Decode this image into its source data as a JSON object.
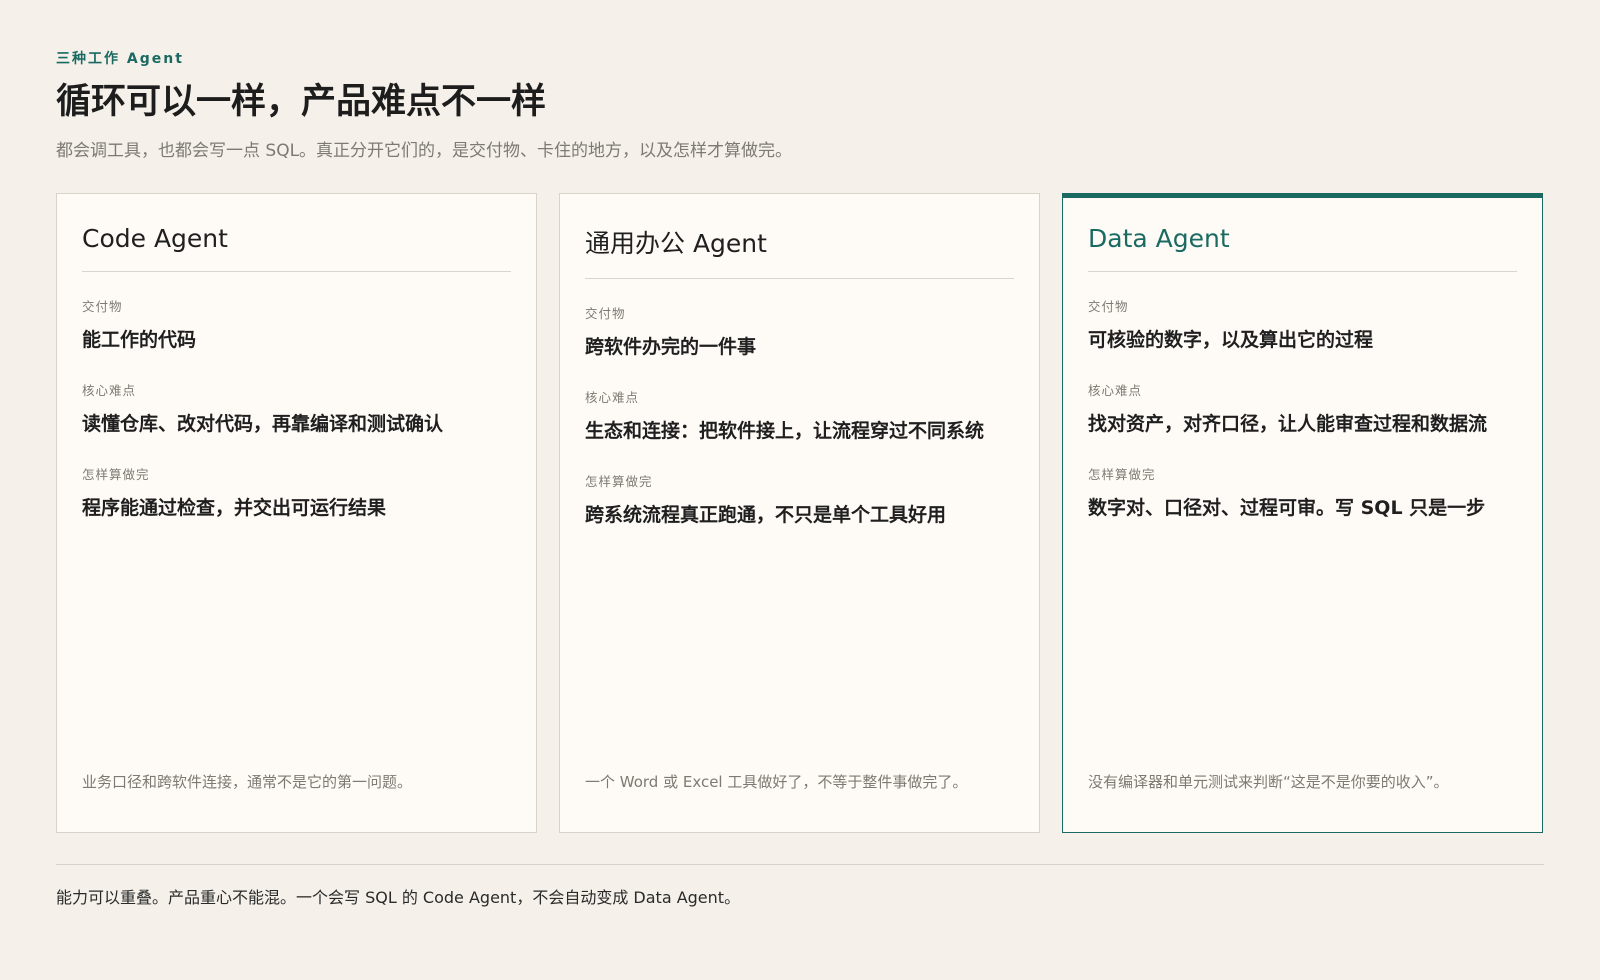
{
  "header": {
    "kicker": "三种工作 Agent",
    "title": "循环可以一样，产品难点不一样",
    "subtitle": "都会调工具，也都会写一点 SQL。真正分开它们的，是交付物、卡住的地方，以及怎样才算做完。"
  },
  "cards": [
    {
      "title": "Code Agent",
      "deliverable_label": "交付物",
      "deliverable": "能工作的代码",
      "difficulty_label": "核心难点",
      "difficulty": "读懂仓库、改对代码，再靠编译和测试确认",
      "done_label": "怎样算做完",
      "done": "程序能通过检查，并交出可运行结果",
      "note": "业务口径和跨软件连接，通常不是它的第一问题。"
    },
    {
      "title": "通用办公 Agent",
      "deliverable_label": "交付物",
      "deliverable": "跨软件办完的一件事",
      "difficulty_label": "核心难点",
      "difficulty": "生态和连接：把软件接上，让流程穿过不同系统",
      "done_label": "怎样算做完",
      "done": "跨系统流程真正跑通，不只是单个工具好用",
      "note": "一个 Word 或 Excel 工具做好了，不等于整件事做完了。"
    },
    {
      "title": "Data Agent",
      "deliverable_label": "交付物",
      "deliverable": "可核验的数字，以及算出它的过程",
      "difficulty_label": "核心难点",
      "difficulty": "找对资产，对齐口径，让人能审查过程和数据流",
      "done_label": "怎样算做完",
      "done": "数字对、口径对、过程可审。写 SQL 只是一步",
      "note": "没有编译器和单元测试来判断“这是不是你要的收入”。"
    }
  ],
  "footer": {
    "text": "能力可以重叠。产品重心不能混。一个会写 SQL 的 Code Agent，不会自动变成 Data Agent。"
  },
  "colors": {
    "background": "#f5f1ea",
    "card_background": "#fefbf6",
    "accent": "#1b6a62",
    "muted_text": "#7d7a73",
    "border": "#d9d4ca"
  }
}
